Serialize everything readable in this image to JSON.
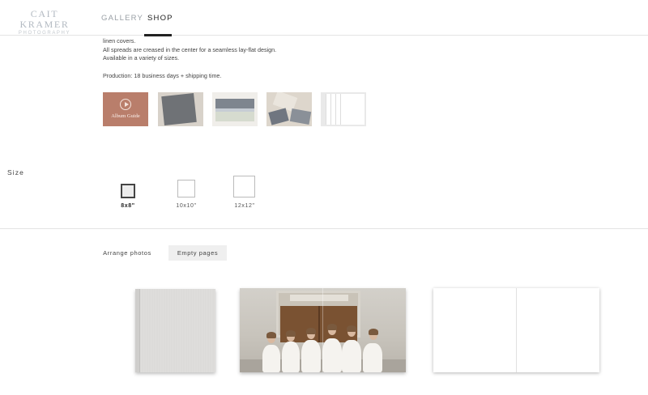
{
  "header": {
    "logo_main": "CAIT KRAMER",
    "logo_sub": "PHOTOGRAPHY",
    "nav": [
      {
        "label": "GALLERY",
        "active": false
      },
      {
        "label": "SHOP",
        "active": true
      }
    ]
  },
  "description": {
    "lines": [
      "linen covers.",
      "All spreads are creased in the center for a seamless lay-flat design.",
      "Available in a variety of sizes."
    ],
    "production": "Production: 18 business days + shipping time."
  },
  "thumbnails": {
    "guide_label": "Album Guide",
    "items": [
      "album-guide-video",
      "album-cover-photo",
      "album-stack-photo",
      "album-flatlay-photo",
      "album-pages-photo"
    ]
  },
  "size": {
    "label": "Size",
    "options": [
      {
        "label": "8x8\"",
        "selected": true
      },
      {
        "label": "10x10\"",
        "selected": false
      },
      {
        "label": "12x12\"",
        "selected": false
      }
    ]
  },
  "tabs": [
    {
      "label": "Arrange photos",
      "active": false
    },
    {
      "label": "Empty pages",
      "active": true
    }
  ],
  "colors": {
    "accent_guide": "#b97e6b",
    "text": "#333333",
    "tab_active_bg": "#efefef",
    "divider": "#e4e4e4"
  }
}
